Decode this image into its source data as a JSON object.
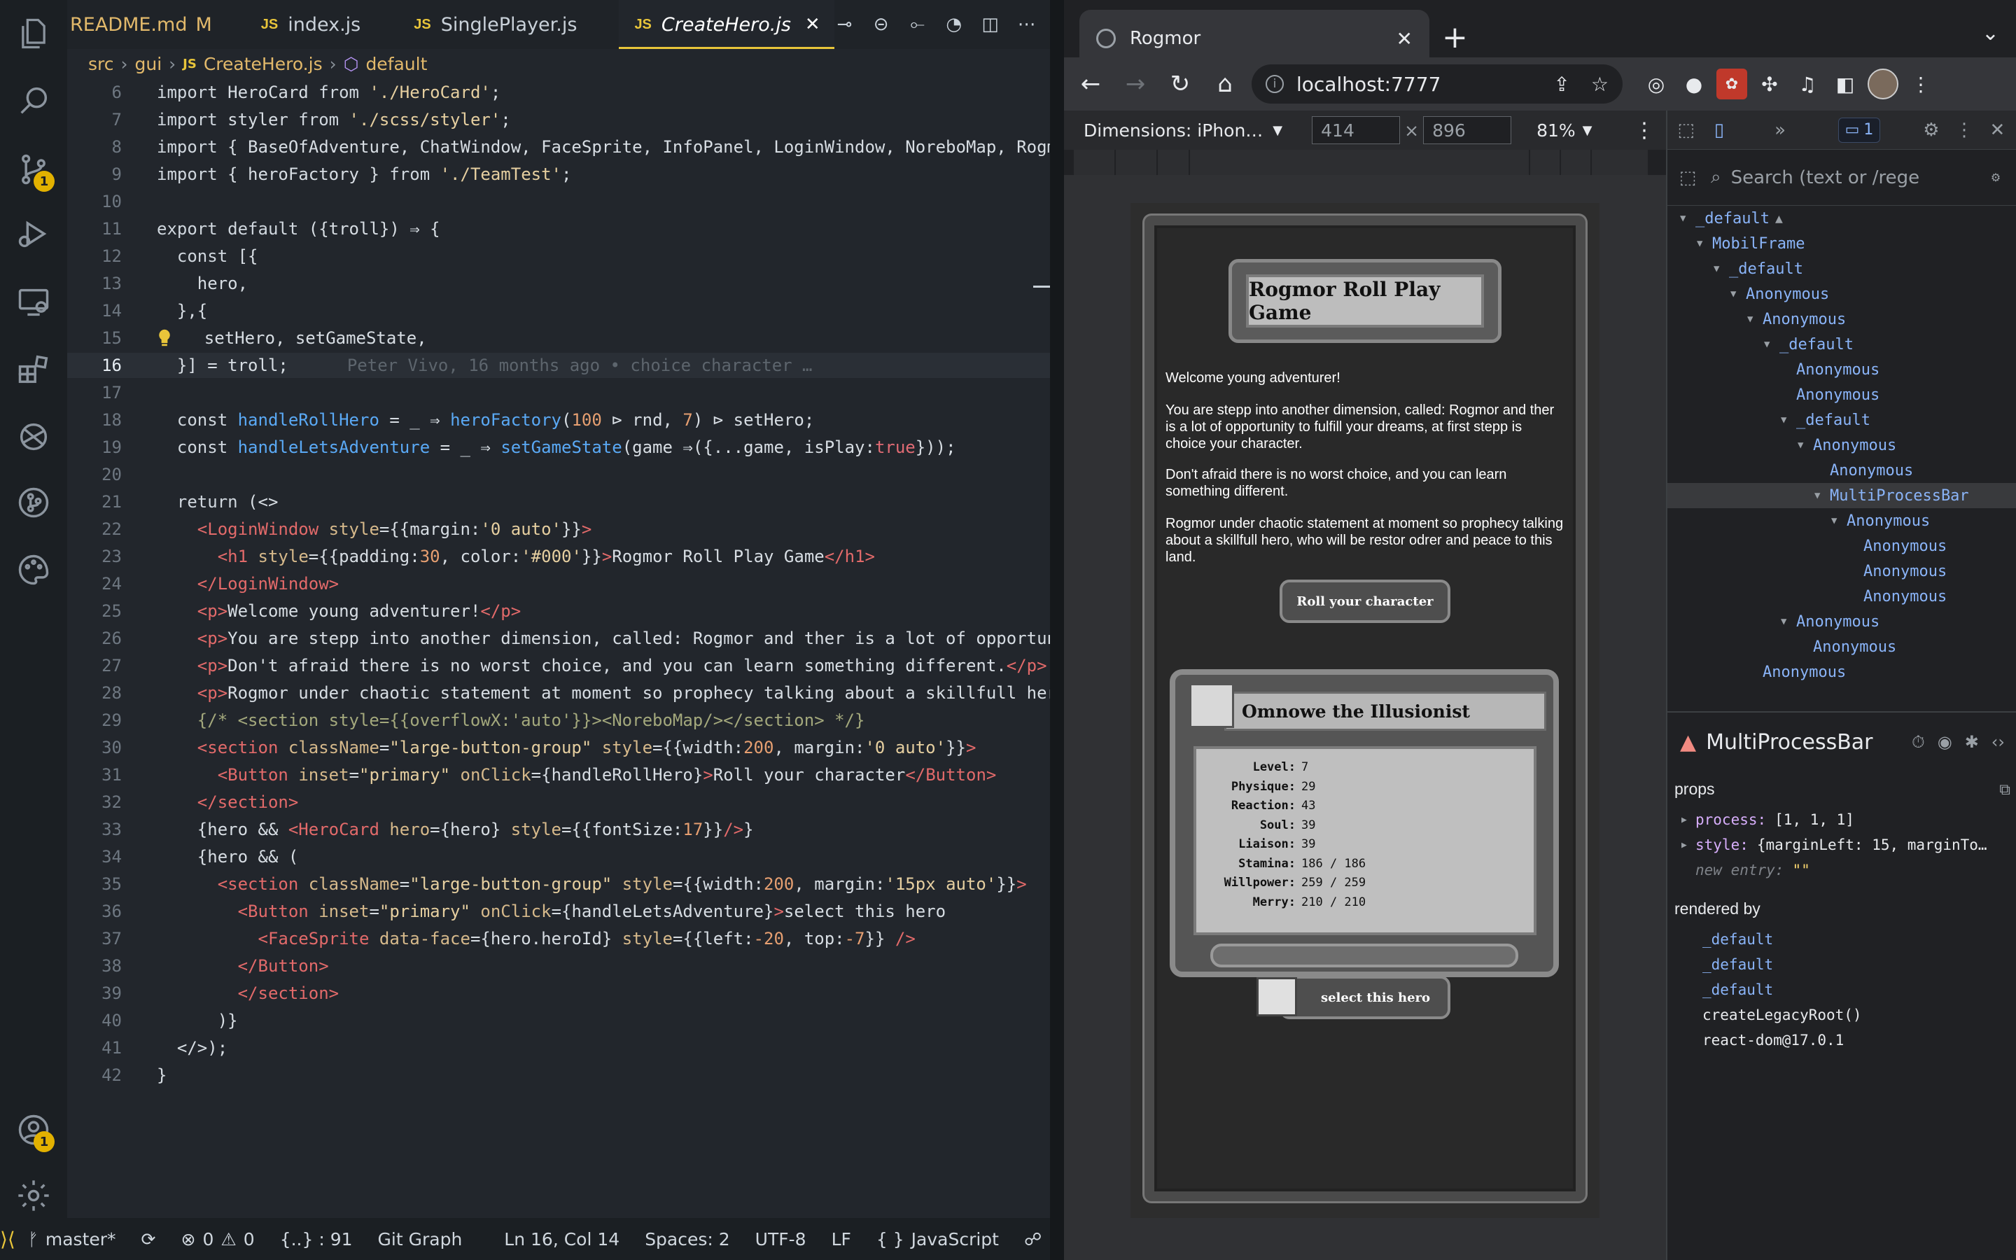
{
  "vscode": {
    "tabs": [
      {
        "label": "README.md",
        "modified": "M",
        "js": false
      },
      {
        "label": "index.js",
        "js": true
      },
      {
        "label": "SinglePlayer.js",
        "js": true
      },
      {
        "label": "CreateHero.js",
        "js": true,
        "active": true
      }
    ],
    "js_badge": "JS",
    "breadcrumb": [
      "src",
      "gui",
      "CreateHero.js",
      "default"
    ],
    "lines": [
      {
        "n": "6",
        "html": "<span class=\"kw\">import</span> HeroCard <span class=\"kw\">from</span> <span class=\"str\">'./HeroCard'</span>;"
      },
      {
        "n": "7",
        "html": "<span class=\"kw\">import</span> styler <span class=\"kw\">from</span> <span class=\"str\">'./scss/styler'</span>;"
      },
      {
        "n": "8",
        "html": "<span class=\"kw\">import</span> { BaseOfAdventure, ChatWindow, FaceSprite, InfoPanel, LoginWindow, NoreboMap, RogmorLogo, E"
      },
      {
        "n": "9",
        "html": "<span class=\"kw\">import</span> { heroFactory } <span class=\"kw\">from</span> <span class=\"str\">'./TeamTest'</span>;"
      },
      {
        "n": "10",
        "html": ""
      },
      {
        "n": "11",
        "html": "<span class=\"kw\">export default</span> ({troll}) ⇒ {"
      },
      {
        "n": "12",
        "html": "  <span class=\"kw\">const</span> [{"
      },
      {
        "n": "13",
        "html": "    hero,"
      },
      {
        "n": "14",
        "html": "  },{"
      },
      {
        "n": "15",
        "html": "    setHero, setGameState,"
      },
      {
        "n": "16",
        "html": "  }] = troll;",
        "cur": true,
        "blame": "Peter Vivo, 16 months ago • choice character …"
      },
      {
        "n": "17",
        "html": ""
      },
      {
        "n": "18",
        "html": "  <span class=\"kw\">const</span> <span class=\"fn\">handleRollHero</span> = _ ⇒ <span class=\"fn\">heroFactory</span>(<span class=\"num\">100</span> ⊳ rnd, <span class=\"num\">7</span>) ⊳ setHero;"
      },
      {
        "n": "19",
        "html": "  <span class=\"kw\">const</span> <span class=\"fn\">handleLetsAdventure</span> = _ ⇒ <span class=\"fn\">setGameState</span>(game ⇒({...game, isPlay:<span class=\"bool\">true</span>}));"
      },
      {
        "n": "20",
        "html": ""
      },
      {
        "n": "21",
        "html": "  <span class=\"kw\">return</span> (&lt;&gt;"
      },
      {
        "n": "22",
        "html": "    <span class=\"tag\">&lt;LoginWindow</span> <span class=\"attr\">style</span>={{margin:<span class=\"str\">'0 auto'</span>}}<span class=\"tag\">&gt;</span>"
      },
      {
        "n": "23",
        "html": "      <span class=\"tag\">&lt;h1</span> <span class=\"attr\">style</span>={{padding:<span class=\"num\">30</span>, color:<span class=\"str\">'#000'</span>}}<span class=\"tag\">&gt;</span>Rogmor Roll Play Game<span class=\"tag\">&lt;/h1&gt;</span>"
      },
      {
        "n": "24",
        "html": "    <span class=\"tag\">&lt;/LoginWindow&gt;</span>"
      },
      {
        "n": "25",
        "html": "    <span class=\"tag\">&lt;p&gt;</span>Welcome young adventurer!<span class=\"tag\">&lt;/p&gt;</span>"
      },
      {
        "n": "26",
        "html": "    <span class=\"tag\">&lt;p&gt;</span>You are stepp into another dimension, called: Rogmor and ther is a lot of opportunity to fu"
      },
      {
        "n": "27",
        "html": "    <span class=\"tag\">&lt;p&gt;</span>Don't afraid there is no worst choice, and you can learn something different.<span class=\"tag\">&lt;/p&gt;</span>"
      },
      {
        "n": "28",
        "html": "    <span class=\"tag\">&lt;p&gt;</span>Rogmor under chaotic statement at moment so prophecy talking about a skillfull hero, who wi"
      },
      {
        "n": "29",
        "html": "    <span class=\"cm\">{/* &lt;section style={{overflowX:'auto'}}&gt;&lt;NoreboMap/&gt;&lt;/section&gt; */}</span>"
      },
      {
        "n": "30",
        "html": "    <span class=\"tag\">&lt;section</span> <span class=\"attr\">className</span>=<span class=\"str\">\"large-button-group\"</span> <span class=\"attr\">style</span>={{width:<span class=\"num\">200</span>, margin:<span class=\"str\">'0 auto'</span>}}<span class=\"tag\">&gt;</span>"
      },
      {
        "n": "31",
        "html": "      <span class=\"tag\">&lt;Button</span> <span class=\"attr\">inset</span>=<span class=\"str\">\"primary\"</span> <span class=\"attr\">onClick</span>={handleRollHero}<span class=\"tag\">&gt;</span>Roll your character<span class=\"tag\">&lt;/Button&gt;</span>"
      },
      {
        "n": "32",
        "html": "    <span class=\"tag\">&lt;/section&gt;</span>"
      },
      {
        "n": "33",
        "html": "    {hero &amp;&amp; <span class=\"tag\">&lt;HeroCard</span> <span class=\"attr\">hero</span>={hero} <span class=\"attr\">style</span>={{fontSize:<span class=\"num\">17</span>}}<span class=\"tag\">/&gt;</span>}"
      },
      {
        "n": "34",
        "html": "    {hero &amp;&amp; ("
      },
      {
        "n": "35",
        "html": "      <span class=\"tag\">&lt;section</span> <span class=\"attr\">className</span>=<span class=\"str\">\"large-button-group\"</span> <span class=\"attr\">style</span>={{width:<span class=\"num\">200</span>, margin:<span class=\"str\">'15px auto'</span>}}<span class=\"tag\">&gt;</span>"
      },
      {
        "n": "36",
        "html": "        <span class=\"tag\">&lt;Button</span> <span class=\"attr\">inset</span>=<span class=\"str\">\"primary\"</span> <span class=\"attr\">onClick</span>={handleLetsAdventure}<span class=\"tag\">&gt;</span>select this hero"
      },
      {
        "n": "37",
        "html": "          <span class=\"tag\">&lt;FaceSprite</span> <span class=\"attr\">data-face</span>={hero.heroId} <span class=\"attr\">style</span>={{left:<span class=\"num\">-20</span>, top:<span class=\"num\">-7</span>}} <span class=\"tag\">/&gt;</span>"
      },
      {
        "n": "38",
        "html": "        <span class=\"tag\">&lt;/Button&gt;</span>"
      },
      {
        "n": "39",
        "html": "        <span class=\"tag\">&lt;/section&gt;</span>"
      },
      {
        "n": "40",
        "html": "      )}"
      },
      {
        "n": "41",
        "html": "  &lt;/&gt;);"
      },
      {
        "n": "42",
        "html": "}"
      }
    ],
    "status": {
      "branch": "master*",
      "errors": "0",
      "warnings": "0",
      "brackets": "{..} : 91",
      "git_graph": "Git Graph",
      "position": "Ln 16, Col 14",
      "spaces": "Spaces: 2",
      "encoding": "UTF-8",
      "eol": "LF",
      "language": "JavaScript",
      "lang_braces": "{ }"
    },
    "activity_badges": {
      "scm": "1",
      "accounts": "1"
    }
  },
  "browser": {
    "tab_title": "Rogmor",
    "url": "localhost:7777",
    "device": {
      "label": "Dimensions: iPhon…",
      "width": "414",
      "height": "896",
      "times": "×",
      "zoom": "81%"
    },
    "page": {
      "title": "Rogmor Roll Play Game",
      "paragraphs": [
        "Welcome young adventurer!",
        "You are stepp into another dimension, called: Rogmor and ther is a lot of opportunity to fulfill your dreams, at first stepp is choice your character.",
        "Don't afraid there is no worst choice, and you can learn something different.",
        "Rogmor under chaotic statement at moment so prophecy talking about a skillfull hero, who will be restor odrer and peace to this land."
      ],
      "roll_button": "Roll your character",
      "hero_name": "Omnowe the Illusionist",
      "stats": [
        {
          "k": "Level:",
          "v": "7"
        },
        {
          "k": "Physique:",
          "v": "29"
        },
        {
          "k": "Reaction:",
          "v": "43"
        },
        {
          "k": "Soul:",
          "v": "39"
        },
        {
          "k": "Liaison:",
          "v": "39"
        },
        {
          "k": "Stamina:",
          "v": "186 / 186"
        },
        {
          "k": "Willpower:",
          "v": "259 / 259"
        },
        {
          "k": "Merry:",
          "v": "210 / 210"
        }
      ],
      "select_button": "select this hero"
    },
    "devtools": {
      "message_count": "1",
      "search_placeholder": "Search (text or /rege",
      "tree": [
        {
          "label": "_default",
          "depth": 0,
          "tri": "▼",
          "warn": true
        },
        {
          "label": "MobilFrame",
          "depth": 1,
          "tri": "▼"
        },
        {
          "label": "_default",
          "depth": 2,
          "tri": "▼"
        },
        {
          "label": "Anonymous",
          "depth": 3,
          "tri": "▼"
        },
        {
          "label": "Anonymous",
          "depth": 4,
          "tri": "▼"
        },
        {
          "label": "_default",
          "depth": 5,
          "tri": "▼"
        },
        {
          "label": "Anonymous",
          "depth": 6,
          "tri": ""
        },
        {
          "label": "Anonymous",
          "depth": 6,
          "tri": ""
        },
        {
          "label": "_default",
          "depth": 6,
          "tri": "▼"
        },
        {
          "label": "Anonymous",
          "depth": 7,
          "tri": "▼"
        },
        {
          "label": "Anonymous",
          "depth": 8,
          "tri": ""
        },
        {
          "label": "MultiProcessBar",
          "depth": 8,
          "tri": "▼",
          "sel": true
        },
        {
          "label": "Anonymous",
          "depth": 9,
          "tri": "▼"
        },
        {
          "label": "Anonymous",
          "depth": 10,
          "tri": ""
        },
        {
          "label": "Anonymous",
          "depth": 10,
          "tri": ""
        },
        {
          "label": "Anonymous",
          "depth": 10,
          "tri": ""
        },
        {
          "label": "Anonymous",
          "depth": 6,
          "tri": "▼"
        },
        {
          "label": "Anonymous",
          "depth": 7,
          "tri": ""
        },
        {
          "label": "Anonymous",
          "depth": 4,
          "tri": ""
        }
      ],
      "selected_component": "MultiProcessBar",
      "props_label": "props",
      "props": [
        {
          "k": "process:",
          "v": "[1, 1, 1]"
        },
        {
          "k": "style:",
          "v": "{marginLeft: 15, marginTo…"
        }
      ],
      "new_entry_key": "new entry:",
      "new_entry_value": "\"\"",
      "rendered_by_label": "rendered by",
      "rendered_by": [
        {
          "label": "_default",
          "link": true
        },
        {
          "label": "_default",
          "link": true
        },
        {
          "label": "_default",
          "link": true
        },
        {
          "label": "createLegacyRoot()",
          "link": false
        },
        {
          "label": "react-dom@17.0.1",
          "link": false
        }
      ]
    }
  }
}
